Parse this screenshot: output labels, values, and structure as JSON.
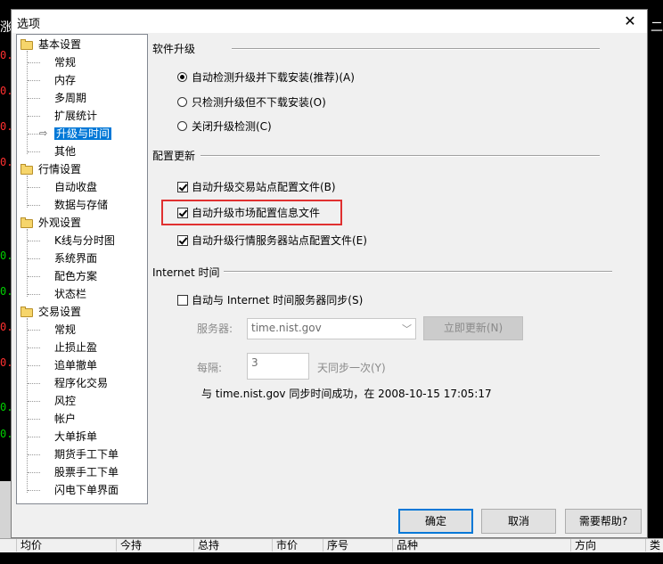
{
  "background": {
    "left_title": "涨",
    "right_title": "二",
    "left_numbers": [
      {
        "text": "0.",
        "color": "#ff3030"
      },
      {
        "text": "0.",
        "color": "#ff3030"
      },
      {
        "text": "0.",
        "color": "#ff3030"
      },
      {
        "text": "0.",
        "color": "#ff3030"
      },
      {
        "text": "0.",
        "color": "#00d000"
      },
      {
        "text": "0.",
        "color": "#00d000"
      },
      {
        "text": "0.",
        "color": "#ff3030"
      },
      {
        "text": "0.",
        "color": "#ff3030"
      },
      {
        "text": "0.",
        "color": "#00d000"
      },
      {
        "text": "0.",
        "color": "#00d000"
      }
    ],
    "bottom_columns": [
      "均价",
      "今持",
      "总持",
      "市价",
      "序号",
      "品种",
      "方向",
      "类型"
    ]
  },
  "dialog": {
    "title": "选项",
    "close_symbol": "✕"
  },
  "tree": {
    "groups": [
      {
        "label": "基本设置",
        "items": [
          "常规",
          "内存",
          "多周期",
          "扩展统计",
          "升级与时间",
          "其他"
        ]
      },
      {
        "label": "行情设置",
        "items": [
          "自动收盘",
          "数据与存储"
        ]
      },
      {
        "label": "外观设置",
        "items": [
          "K线与分时图",
          "系统界面",
          "配色方案",
          "状态栏"
        ]
      },
      {
        "label": "交易设置",
        "items": [
          "常规",
          "止损止盈",
          "追单撤单",
          "程序化交易",
          "风控",
          "帐户",
          "大单拆单",
          "期货手工下单",
          "股票手工下单",
          "闪电下单界面"
        ]
      }
    ],
    "selected": "升级与时间"
  },
  "software_upgrade": {
    "section_label": "软件升级",
    "options": [
      {
        "label": "自动检测升级并下载安装(推荐)(A)",
        "selected": true
      },
      {
        "label": "只检测升级但不下载安装(O)",
        "selected": false
      },
      {
        "label": "关闭升级检测(C)",
        "selected": false
      }
    ]
  },
  "config_update": {
    "section_label": "配置更新",
    "options": [
      {
        "label": "自动升级交易站点配置文件(B)",
        "checked": true
      },
      {
        "label": "自动升级市场配置信息文件",
        "checked": true
      },
      {
        "label": "自动升级行情服务器站点配置文件(E)",
        "checked": true
      }
    ]
  },
  "internet_time": {
    "section_label": "Internet 时间",
    "sync_label": "自动与 Internet 时间服务器同步(S)",
    "sync_checked": false,
    "server_label": "服务器:",
    "server_value": "time.nist.gov",
    "update_button": "立即更新(N)",
    "interval_label": "每隔:",
    "interval_value": "3",
    "interval_suffix": "天同步一次(Y)",
    "status": "与 time.nist.gov 同步时间成功，在 2008-10-15 17:05:17"
  },
  "buttons": {
    "ok": "确定",
    "cancel": "取消",
    "help": "需要帮助?"
  }
}
